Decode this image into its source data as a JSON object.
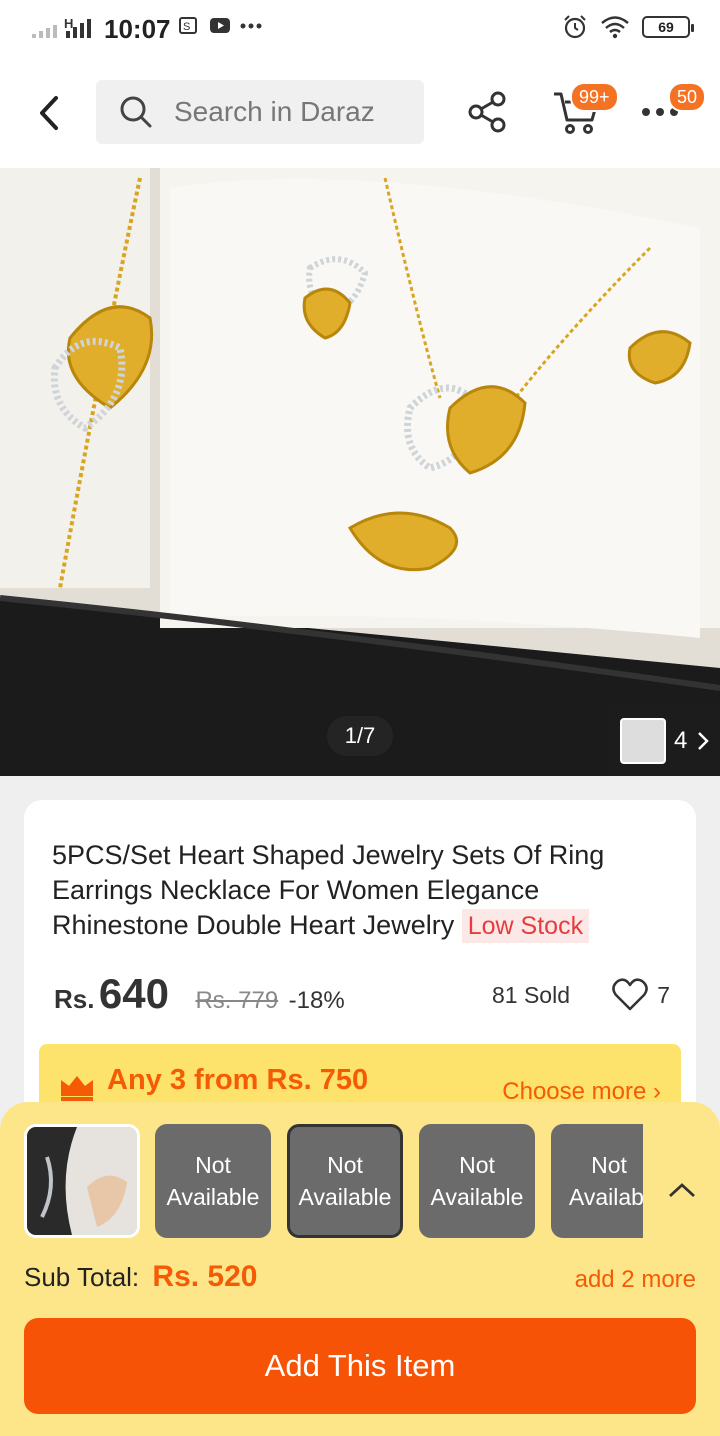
{
  "status_bar": {
    "time": "10:07",
    "battery": "69"
  },
  "header": {
    "search_placeholder": "Search in Daraz",
    "cart_badge": "99+",
    "more_badge": "50"
  },
  "gallery": {
    "counter": "1/7",
    "more_count": "4"
  },
  "product": {
    "title": "5PCS/Set Heart Shaped Jewelry Sets Of Ring Earrings Necklace For Women Elegance Rhinestone Double Heart Jewelry",
    "stock_tag": "Low Stock",
    "currency": "Rs.",
    "price": "640",
    "original_price": "Rs. 779",
    "discount": "-18%",
    "sold": "81 Sold",
    "likes": "7"
  },
  "promo": {
    "title": "Any 3 from Rs. 750",
    "choose_more": "Choose more ›"
  },
  "bundle": {
    "slots": [
      {
        "status": ""
      },
      {
        "line1": "Not",
        "line2": "Available"
      },
      {
        "line1": "Not",
        "line2": "Available"
      },
      {
        "line1": "Not",
        "line2": "Available"
      },
      {
        "line1": "Not",
        "line2": "Availabl"
      }
    ],
    "subtotal_label": "Sub Total:",
    "subtotal_amount": "Rs. 520",
    "add_more": "add 2 more",
    "add_button": "Add This Item"
  },
  "colors": {
    "accent": "#f57224",
    "button": "#f75306",
    "sheet": "#fde68a"
  }
}
